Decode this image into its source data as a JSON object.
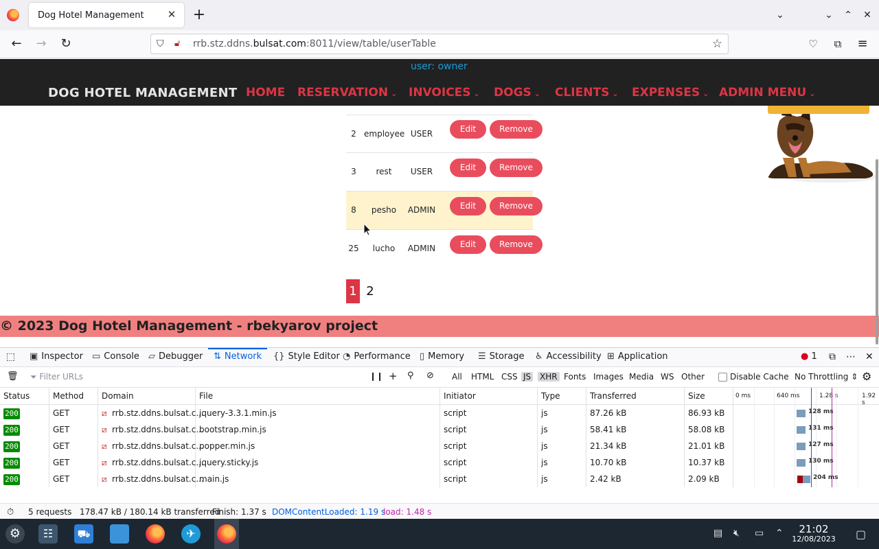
{
  "browser": {
    "tab_title": "Dog Hotel Management",
    "url_host_prefix": "rrb.stz.ddns.",
    "url_host_main": "bulsat.com",
    "url_rest": ":8011/view/table/userTable"
  },
  "site": {
    "user_label": "user: owner",
    "brand": "DOG HOTEL MANAGEMENT",
    "menu": [
      "HOME",
      "RESERVATION",
      "INVOICES",
      "DOGS",
      "CLIENTS",
      "EXPENSES",
      "ADMIN MENU"
    ],
    "users": [
      {
        "id": "2",
        "name": "employee",
        "role": "USER"
      },
      {
        "id": "3",
        "name": "rest",
        "role": "USER"
      },
      {
        "id": "8",
        "name": "pesho",
        "role": "ADMIN"
      },
      {
        "id": "25",
        "name": "lucho",
        "role": "ADMIN"
      }
    ],
    "edit_label": "Edit",
    "remove_label": "Remove",
    "pages": [
      "1",
      "2"
    ],
    "footer": "© 2023 Dog Hotel Management - rbekyarov project"
  },
  "devtools": {
    "tabs": [
      "Inspector",
      "Console",
      "Debugger",
      "Network",
      "Style Editor",
      "Performance",
      "Memory",
      "Storage",
      "Accessibility",
      "Application"
    ],
    "active_tab": "Network",
    "error_count": "1",
    "filter_placeholder": "Filter URLs",
    "type_filters": [
      "All",
      "HTML",
      "CSS",
      "JS",
      "XHR",
      "Fonts",
      "Images",
      "Media",
      "WS",
      "Other"
    ],
    "disable_cache": "Disable Cache",
    "throttling": "No Throttling",
    "columns": [
      "Status",
      "Method",
      "Domain",
      "File",
      "Initiator",
      "Type",
      "Transferred",
      "Size"
    ],
    "waterfall_ticks": [
      "0 ms",
      "640 ms",
      "1.28 s",
      "1.92 s"
    ],
    "requests": [
      {
        "status": "200",
        "method": "GET",
        "domain": "rrb.stz.ddns.bulsat.c...",
        "file": "jquery-3.3.1.min.js",
        "initiator": "script",
        "type": "js",
        "transferred": "87.26 kB",
        "size": "86.93 kB",
        "time": "128 ms"
      },
      {
        "status": "200",
        "method": "GET",
        "domain": "rrb.stz.ddns.bulsat.c...",
        "file": "bootstrap.min.js",
        "initiator": "script",
        "type": "js",
        "transferred": "58.41 kB",
        "size": "58.08 kB",
        "time": "131 ms"
      },
      {
        "status": "200",
        "method": "GET",
        "domain": "rrb.stz.ddns.bulsat.c...",
        "file": "popper.min.js",
        "initiator": "script",
        "type": "js",
        "transferred": "21.34 kB",
        "size": "21.01 kB",
        "time": "127 ms"
      },
      {
        "status": "200",
        "method": "GET",
        "domain": "rrb.stz.ddns.bulsat.c...",
        "file": "jquery.sticky.js",
        "initiator": "script",
        "type": "js",
        "transferred": "10.70 kB",
        "size": "10.37 kB",
        "time": "130 ms"
      },
      {
        "status": "200",
        "method": "GET",
        "domain": "rrb.stz.ddns.bulsat.c...",
        "file": "main.js",
        "initiator": "script",
        "type": "js",
        "transferred": "2.42 kB",
        "size": "2.09 kB",
        "time": "204 ms"
      }
    ],
    "summary": {
      "requests": "5 requests",
      "transferred": "178.47 kB / 180.14 kB transferred",
      "finish": "Finish: 1.37 s",
      "domcontentloaded": "DOMContentLoaded: 1.19 s",
      "load": "load: 1.48 s"
    }
  },
  "taskbar": {
    "time": "21:02",
    "date": "12/08/2023"
  },
  "colors": {
    "accent_red": "#dc3545",
    "devtools_blue": "#0060df",
    "footer_bg": "#f08080"
  }
}
